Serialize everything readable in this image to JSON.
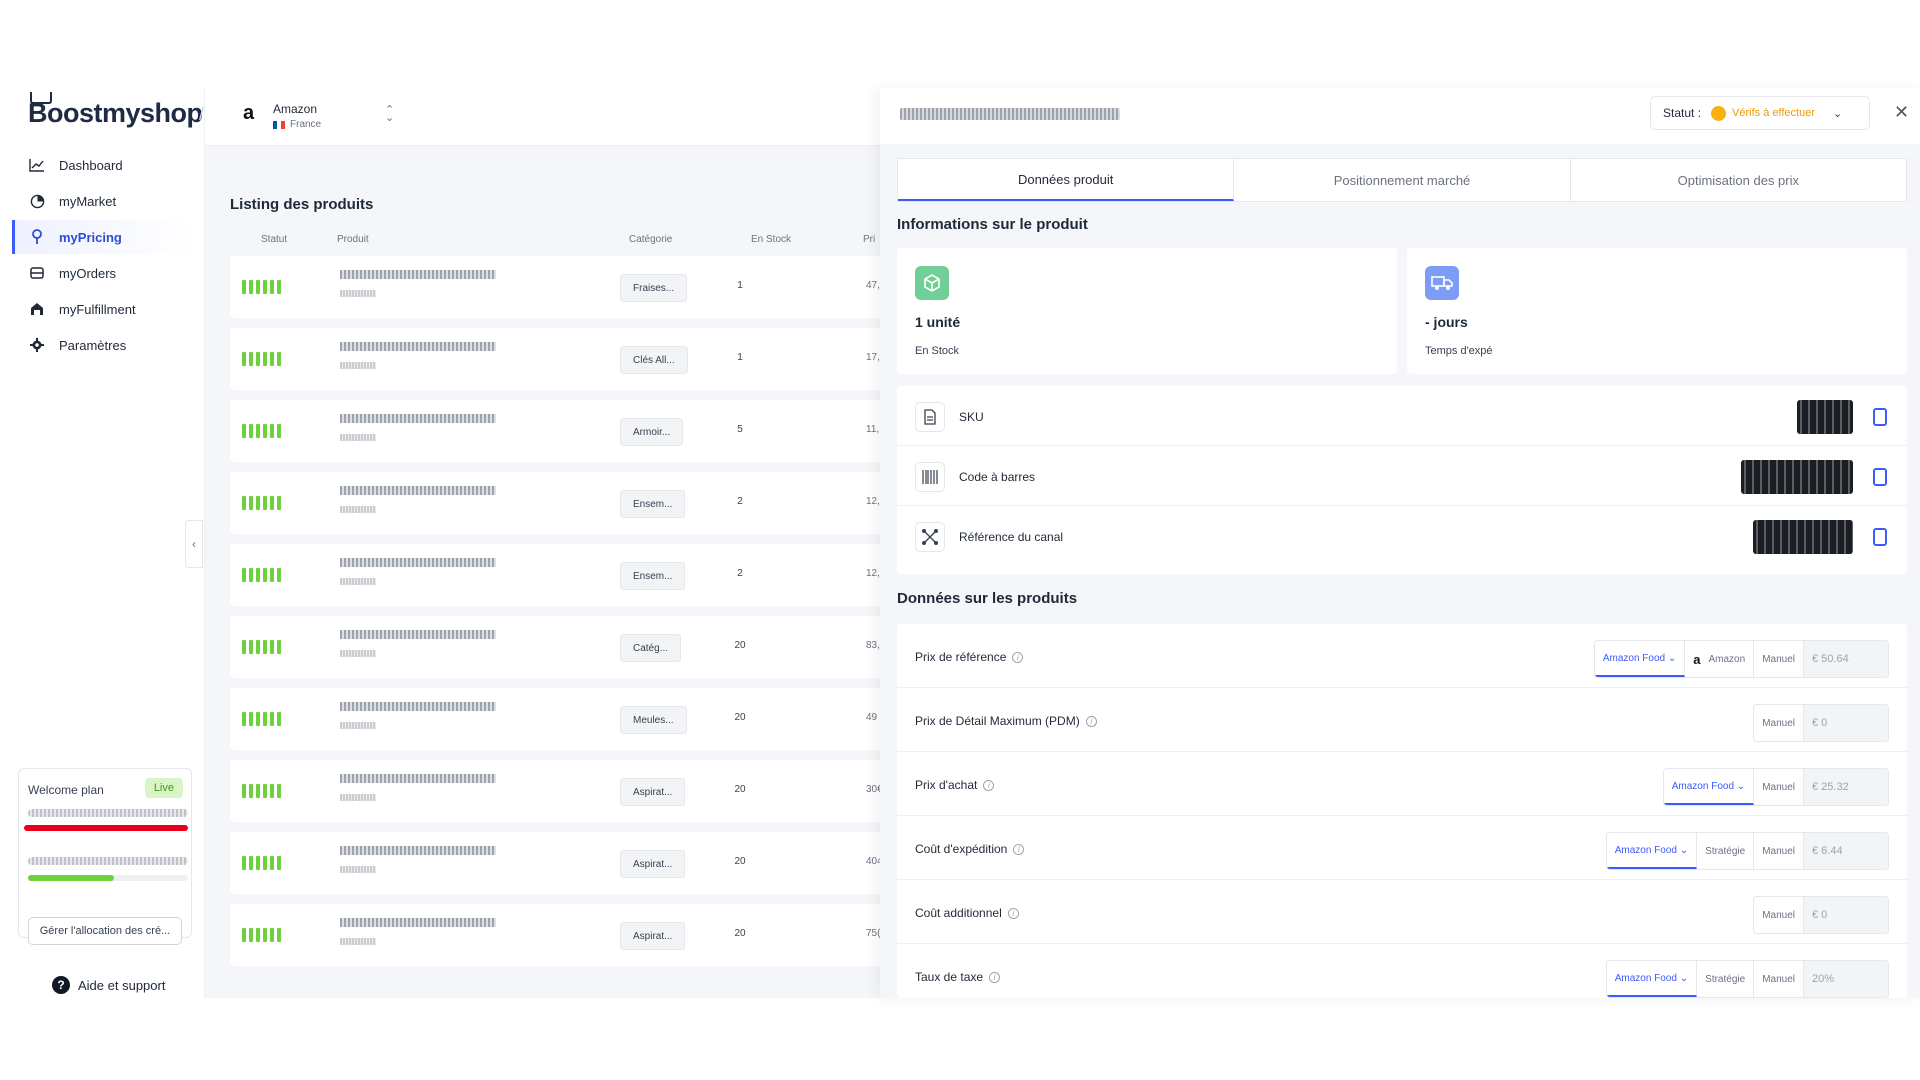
{
  "sidebar": {
    "logo": "Boostmyshop",
    "items": [
      {
        "label": "Dashboard",
        "icon": "chart-line-icon"
      },
      {
        "label": "myMarket",
        "icon": "globe-icon"
      },
      {
        "label": "myPricing",
        "icon": "pin-icon"
      },
      {
        "label": "myOrders",
        "icon": "box-icon"
      },
      {
        "label": "myFulfillment",
        "icon": "warehouse-icon"
      },
      {
        "label": "Paramètres",
        "icon": "gear-icon"
      }
    ],
    "plan": {
      "title": "Welcome plan",
      "badge": "Live",
      "button": "Gérer l'allocation des cré..."
    },
    "help": "Aide et support"
  },
  "topbar": {
    "store_logo": "a",
    "store_name": "Amazon",
    "store_country": "France"
  },
  "listing": {
    "title": "Listing des produits",
    "columns": [
      "Statut",
      "Produit",
      "Catégorie",
      "En Stock",
      "Pri"
    ],
    "rows": [
      {
        "name": "Fraises...",
        "category": "Fraises...",
        "stock": "1",
        "price": "47,"
      },
      {
        "name": "Clés All...",
        "category": "Clés All...",
        "stock": "1",
        "price": "17,"
      },
      {
        "name": "Armoir...",
        "category": "Armoir...",
        "stock": "5",
        "price": "11,"
      },
      {
        "name": "Ensem...",
        "category": "Ensem...",
        "stock": "2",
        "price": "12,"
      },
      {
        "name": "Ensem...",
        "category": "Ensem...",
        "stock": "2",
        "price": "12,"
      },
      {
        "name": "Catég...",
        "category": "Catég...",
        "stock": "20",
        "price": "83,"
      },
      {
        "name": "Meules...",
        "category": "Meules...",
        "stock": "20",
        "price": "49"
      },
      {
        "name": "Aspirat...",
        "category": "Aspirat...",
        "stock": "20",
        "price": "30€"
      },
      {
        "name": "Aspirat...",
        "category": "Aspirat...",
        "stock": "20",
        "price": "404"
      },
      {
        "name": "Aspirat...",
        "category": "Aspirat...",
        "stock": "20",
        "price": "75("
      }
    ]
  },
  "panel": {
    "status_label": "Statut :",
    "status_value": "Vérifs à effectuer",
    "tabs": [
      "Données produit",
      "Positionnement marché",
      "Optimisation des prix"
    ],
    "info_title": "Informations sur le produit",
    "stock_value": "1 unité",
    "stock_label": "En Stock",
    "ship_value": "- jours",
    "ship_label": "Temps d'expé",
    "ids": [
      {
        "label": "SKU",
        "icon": "document-icon"
      },
      {
        "label": "Code à barres",
        "icon": "barcode-icon"
      },
      {
        "label": "Référence du canal",
        "icon": "network-icon"
      }
    ],
    "data_title": "Données sur les produits",
    "data_rows": [
      {
        "label": "Prix de référence",
        "source": "Amazon Food",
        "alt": "Amazon",
        "manual": "Manuel",
        "value": "€ 50.64"
      },
      {
        "label": "Prix de Détail Maximum (PDM)",
        "manual": "Manuel",
        "value": "€ 0"
      },
      {
        "label": "Prix d'achat",
        "source": "Amazon Food",
        "manual": "Manuel",
        "value": "€ 25.32"
      },
      {
        "label": "Coût d'expédition",
        "source": "Amazon Food",
        "strategy": "Stratégie",
        "manual": "Manuel",
        "value": "€ 6.44"
      },
      {
        "label": "Coût additionnel",
        "manual": "Manuel",
        "value": "€ 0"
      },
      {
        "label": "Taux de taxe",
        "source": "Amazon Food",
        "strategy": "Stratégie",
        "manual": "Manuel",
        "value": "20%"
      }
    ]
  },
  "colors": {
    "accent": "#3b5bfd",
    "status_green": "#6cd13b",
    "warning": "#f9b10f"
  }
}
